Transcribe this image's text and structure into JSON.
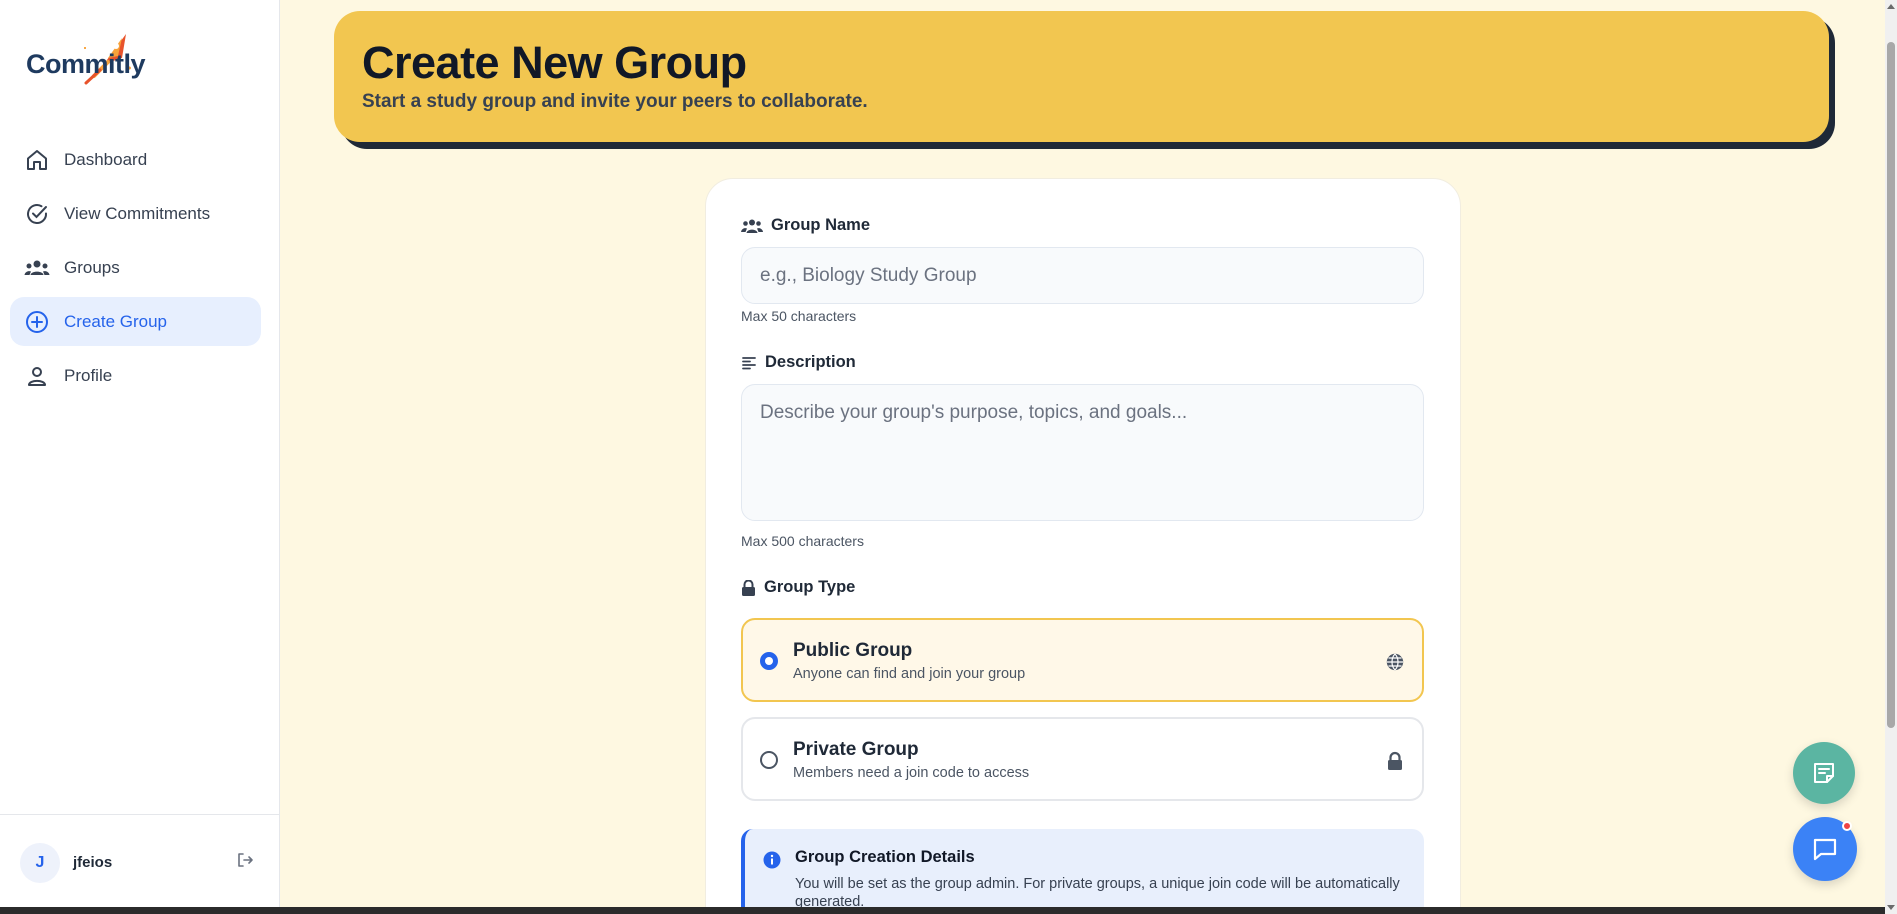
{
  "brand": {
    "name": "Commitly",
    "logo_icon": "rocket-icon"
  },
  "sidebar": {
    "items": [
      {
        "label": "Dashboard",
        "icon": "home-icon",
        "active": false
      },
      {
        "label": "View Commitments",
        "icon": "check-circle-icon",
        "active": false
      },
      {
        "label": "Groups",
        "icon": "groups-icon",
        "active": false
      },
      {
        "label": "Create Group",
        "icon": "plus-circle-icon",
        "active": true
      },
      {
        "label": "Profile",
        "icon": "person-icon",
        "active": false
      }
    ],
    "user": {
      "initial": "J",
      "name": "jfeios"
    }
  },
  "header": {
    "title": "Create New Group",
    "subtitle": "Start a study group and invite your peers to collaborate."
  },
  "form": {
    "group_name": {
      "label": "Group Name",
      "value": "",
      "placeholder": "e.g., Biology Study Group",
      "hint": "Max 50 characters"
    },
    "description": {
      "label": "Description",
      "value": "",
      "placeholder": "Describe your group's purpose, topics, and goals...",
      "hint": "Max 500 characters"
    },
    "group_type": {
      "label": "Group Type",
      "selected": "public",
      "options": [
        {
          "id": "public",
          "title": "Public Group",
          "description": "Anyone can find and join your group",
          "icon": "globe-icon"
        },
        {
          "id": "private",
          "title": "Private Group",
          "description": "Members need a join code to access",
          "icon": "lock-icon"
        }
      ]
    },
    "info": {
      "title": "Group Creation Details",
      "text": "You will be set as the group admin. For private groups, a unique join code will be automatically generated."
    }
  },
  "colors": {
    "accent": "#2563eb",
    "banner": "#f2c650",
    "page_bg": "#fef8e1",
    "notes_fab": "#5bb5a2",
    "chat_fab": "#3b82f6",
    "notification_dot": "#ef4444"
  }
}
